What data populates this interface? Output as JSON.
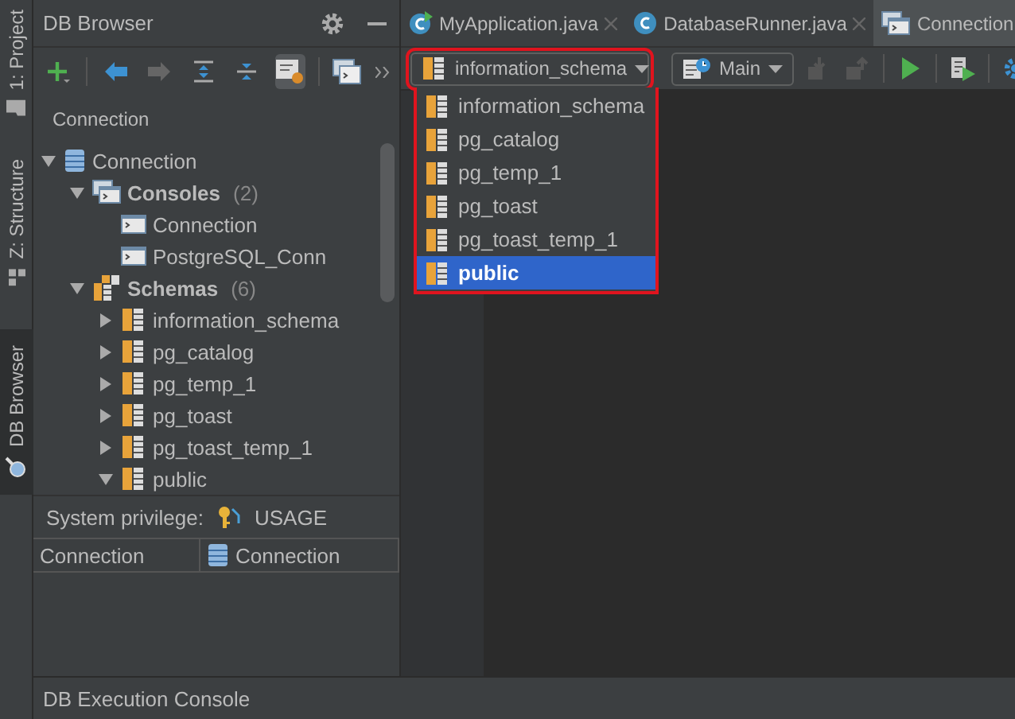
{
  "side_tabs": [
    {
      "label": "1: Project",
      "kind": "folder",
      "selected": false
    },
    {
      "label": "Z: Structure",
      "kind": "structure",
      "selected": false
    },
    {
      "label": "DB Browser",
      "kind": "browser",
      "selected": true
    }
  ],
  "panel": {
    "title": "DB Browser",
    "section_label": "Connection"
  },
  "tree": [
    {
      "label": "Connection",
      "kind": "connection",
      "expanded": true,
      "children": [
        {
          "label": "Consoles",
          "count": "(2)",
          "kind": "consoles",
          "expanded": true,
          "children": [
            {
              "label": "Connection",
              "kind": "console"
            },
            {
              "label": "PostgreSQL_Conn",
              "kind": "console"
            }
          ]
        },
        {
          "label": "Schemas",
          "count": "(6)",
          "kind": "schemas",
          "expanded": true,
          "children": [
            {
              "label": "information_schema",
              "kind": "schema",
              "expanded": false
            },
            {
              "label": "pg_catalog",
              "kind": "schema",
              "expanded": false
            },
            {
              "label": "pg_temp_1",
              "kind": "schema",
              "expanded": false
            },
            {
              "label": "pg_toast",
              "kind": "schema",
              "expanded": false
            },
            {
              "label": "pg_toast_temp_1",
              "kind": "schema",
              "expanded": false
            },
            {
              "label": "public",
              "kind": "schema",
              "expanded": true
            }
          ]
        }
      ]
    }
  ],
  "privilege": {
    "label": "System privilege:",
    "value": "USAGE"
  },
  "details_table": {
    "columns": [
      {
        "label": "Connection",
        "kind": "text"
      },
      {
        "label": "Connection",
        "kind": "connection"
      }
    ]
  },
  "editor_tabs": [
    {
      "label": "MyApplication.java",
      "kind": "runnable-class",
      "selected": false
    },
    {
      "label": "DatabaseRunner.java",
      "kind": "class",
      "selected": false
    },
    {
      "label": "Connection",
      "kind": "console",
      "selected": true
    }
  ],
  "schema_selector": {
    "value": "information_schema",
    "highlighted": true
  },
  "schema_options": [
    {
      "label": "information_schema",
      "selected": false
    },
    {
      "label": "pg_catalog",
      "selected": false
    },
    {
      "label": "pg_temp_1",
      "selected": false
    },
    {
      "label": "pg_toast",
      "selected": false
    },
    {
      "label": "pg_toast_temp_1",
      "selected": false
    },
    {
      "label": "public",
      "selected": true
    }
  ],
  "session_selector": {
    "value": "Main"
  },
  "bottom_bar": {
    "label": "DB Execution Console"
  }
}
